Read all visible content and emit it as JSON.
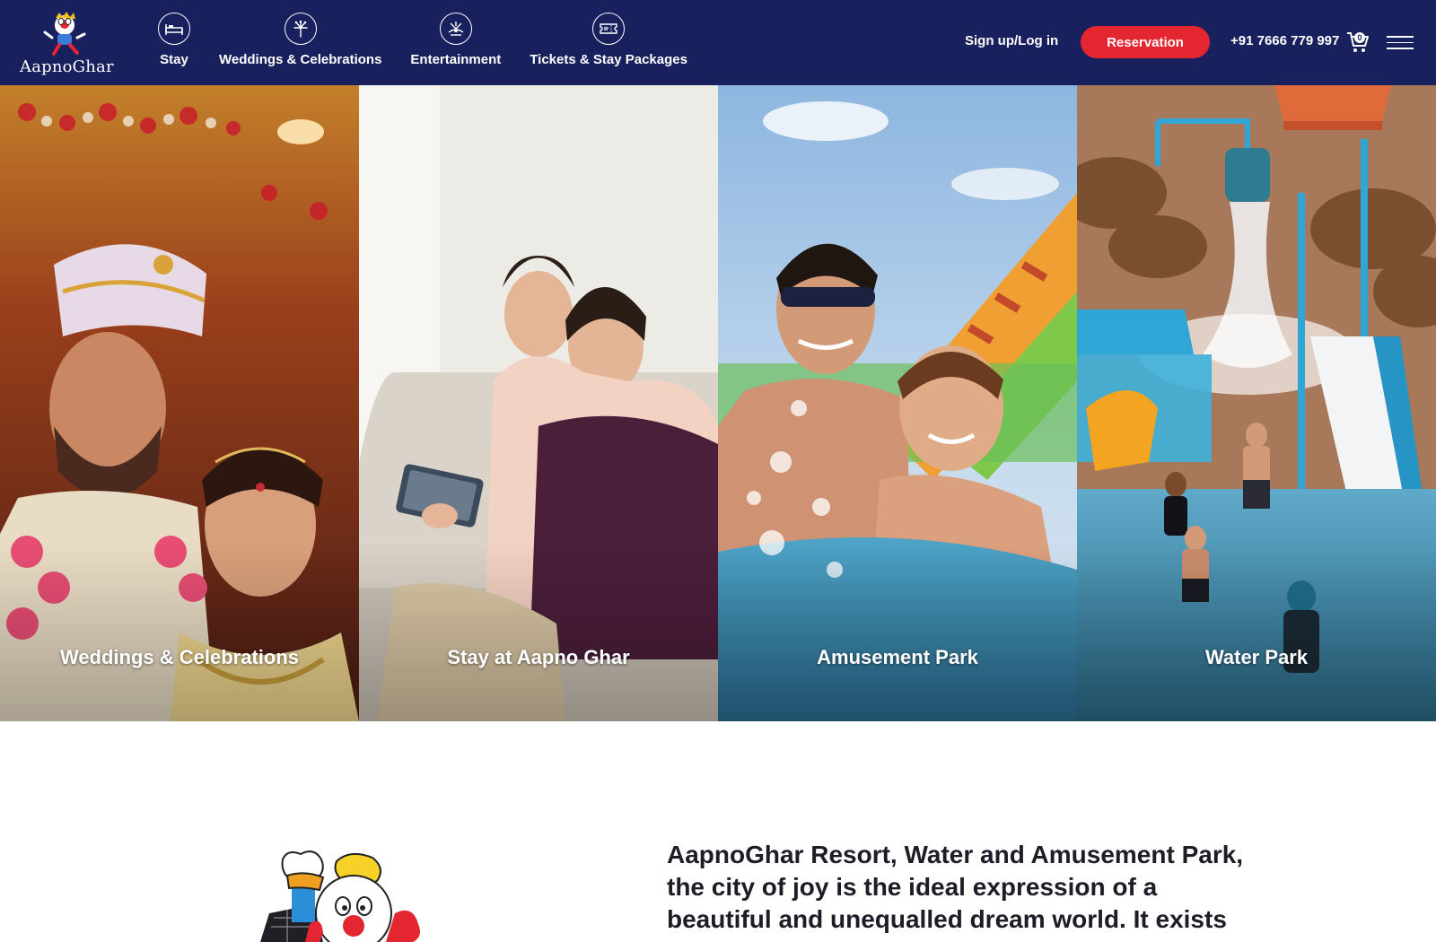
{
  "header": {
    "logo_text": "AapnoGhar",
    "nav": [
      {
        "label": "Stay",
        "icon": "bed-icon"
      },
      {
        "label": "Weddings & Celebrations",
        "icon": "fireworks-icon"
      },
      {
        "label": "Entertainment",
        "icon": "ride-icon"
      },
      {
        "label": "Tickets & Stay Packages",
        "icon": "ticket-icon"
      }
    ],
    "signup_label": "Sign up/Log in",
    "reservation_label": "Reservation",
    "phone": "+91 7666 779 997",
    "cart_count": "0",
    "menu_icon": "hamburger-icon"
  },
  "tiles": [
    {
      "label": "Weddings & Celebrations"
    },
    {
      "label": "Stay at Aapno Ghar"
    },
    {
      "label": "Amusement Park"
    },
    {
      "label": "Water Park"
    }
  ],
  "intro": {
    "text": "AapnoGhar Resort, Water and Amusement Park, the city of joy is the ideal expression of a beautiful and unequalled dream world. It exists"
  },
  "colors": {
    "header_bg": "#19205e",
    "reservation_bg": "#e3262f",
    "text_dark": "#1d1d28"
  }
}
